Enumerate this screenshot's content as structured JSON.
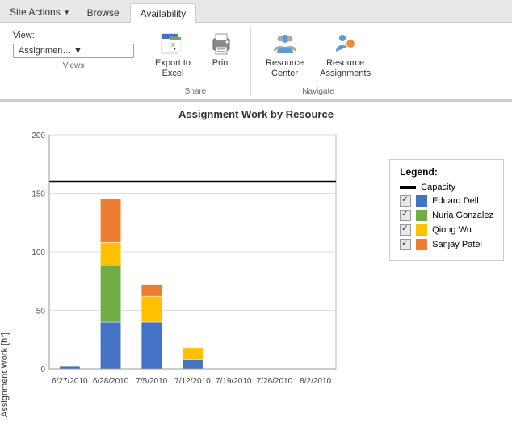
{
  "tabs": {
    "site_actions": "Site Actions",
    "browse": "Browse",
    "availability": "Availability"
  },
  "view": {
    "label": "View:",
    "dropdown_value": "Assignment Work by reso...",
    "section_label": "Views"
  },
  "ribbon": {
    "share": {
      "label": "Share",
      "export_excel": "Export to\nExcel",
      "print": "Print"
    },
    "navigate": {
      "label": "Navigate",
      "resource_center": "Resource\nCenter",
      "resource_assignments": "Resource\nAssignments"
    }
  },
  "chart": {
    "title": "Assignment Work by Resource",
    "y_axis_label": "Assignment Work [hr]",
    "y_max": 200,
    "y_line": 160,
    "y_ticks": [
      0,
      50,
      100,
      150,
      200
    ],
    "x_labels": [
      "6/27/2010",
      "6/28/2010",
      "7/5/2010",
      "7/12/2010",
      "7/19/2010",
      "7/26/2010",
      "8/2/2010"
    ],
    "bars": [
      {
        "x_label": "6/27/2010",
        "segments": [
          {
            "color": "#4472C4",
            "value": 2
          },
          {
            "color": "#70AD47",
            "value": 0
          },
          {
            "color": "#FFC000",
            "value": 0
          },
          {
            "color": "#ED7D31",
            "value": 0
          }
        ]
      },
      {
        "x_label": "6/28/2010",
        "segments": [
          {
            "color": "#4472C4",
            "value": 40
          },
          {
            "color": "#70AD47",
            "value": 48
          },
          {
            "color": "#FFC000",
            "value": 20
          },
          {
            "color": "#ED7D31",
            "value": 37
          }
        ]
      },
      {
        "x_label": "7/5/2010",
        "segments": [
          {
            "color": "#4472C4",
            "value": 40
          },
          {
            "color": "#70AD47",
            "value": 0
          },
          {
            "color": "#FFC000",
            "value": 22
          },
          {
            "color": "#ED7D31",
            "value": 10
          }
        ]
      },
      {
        "x_label": "7/12/2010",
        "segments": [
          {
            "color": "#4472C4",
            "value": 8
          },
          {
            "color": "#70AD47",
            "value": 0
          },
          {
            "color": "#FFC000",
            "value": 10
          },
          {
            "color": "#ED7D31",
            "value": 0
          }
        ]
      },
      {
        "x_label": "7/19/2010",
        "segments": []
      },
      {
        "x_label": "7/26/2010",
        "segments": []
      },
      {
        "x_label": "8/2/2010",
        "segments": []
      }
    ],
    "legend": {
      "title": "Legend:",
      "items": [
        {
          "type": "line",
          "label": "Capacity"
        },
        {
          "type": "color",
          "color": "#4472C4",
          "label": "Eduard Dell"
        },
        {
          "type": "color",
          "color": "#70AD47",
          "label": "Nuria Gonzalez"
        },
        {
          "type": "color",
          "color": "#FFC000",
          "label": "Qiong Wu"
        },
        {
          "type": "color",
          "color": "#ED7D31",
          "label": "Sanjay Patel"
        }
      ]
    }
  }
}
